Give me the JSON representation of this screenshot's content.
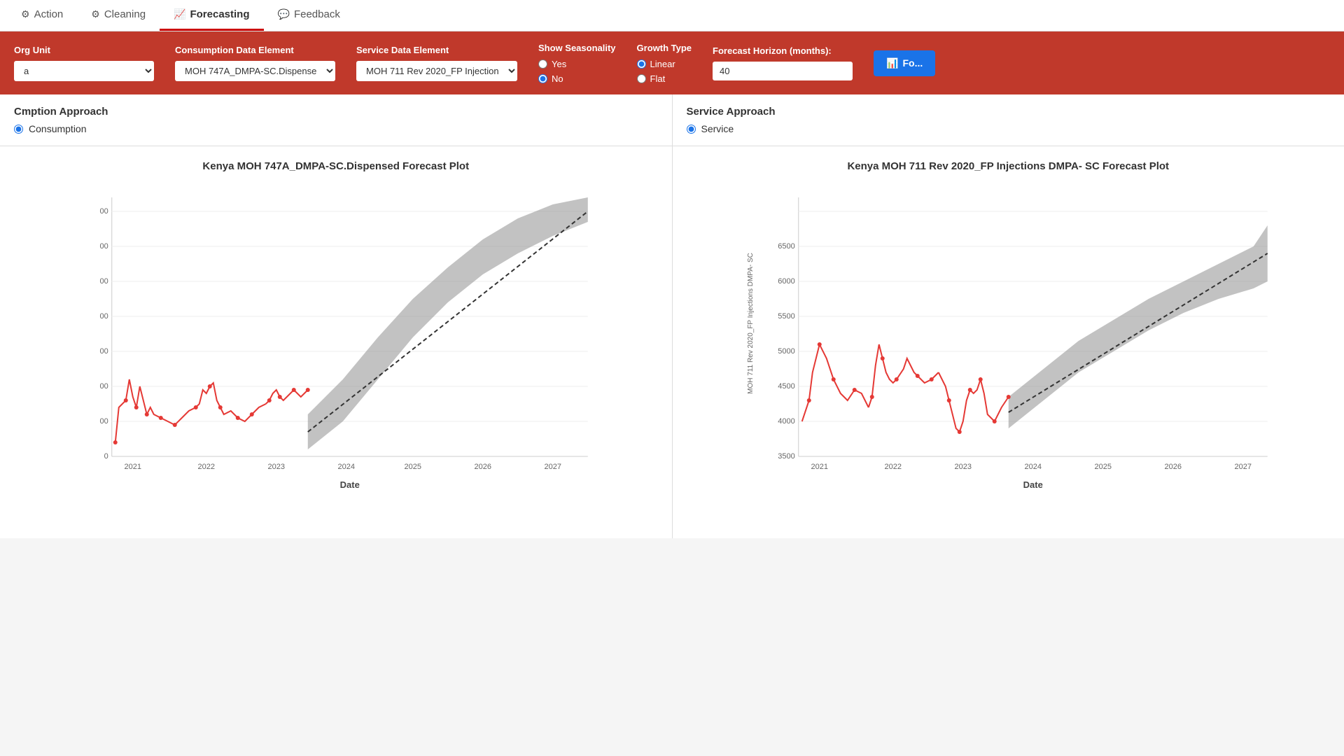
{
  "nav": {
    "tabs": [
      {
        "id": "action",
        "label": "Action",
        "icon": "⚙",
        "active": false
      },
      {
        "id": "cleaning",
        "label": "Cleaning",
        "icon": "⚙",
        "active": false
      },
      {
        "id": "forecasting",
        "label": "Forecasting",
        "icon": "📈",
        "active": true
      },
      {
        "id": "feedback",
        "label": "Feedback",
        "icon": "💬",
        "active": false
      }
    ]
  },
  "toolbar": {
    "org_unit_label": "Org Unit",
    "org_unit_value": "a",
    "consumption_label": "Consumption Data Element",
    "consumption_value": "MOH 747A_DMPA-SC.Dispense",
    "service_label": "Service Data Element",
    "service_value": "MOH 711 Rev 2020_FP Injection",
    "seasonality_label": "Show Seasonality",
    "seasonality_yes": "Yes",
    "seasonality_no": "No",
    "seasonality_selected": "no",
    "growth_label": "Growth Type",
    "growth_linear": "Linear",
    "growth_flat": "Flat",
    "growth_selected": "linear",
    "horizon_label": "Forecast Horizon (months):",
    "horizon_value": "40",
    "forecast_btn": "Fo..."
  },
  "consumption": {
    "section_title": "mption Approach",
    "radio_label": "nsumption",
    "radio_selected": true
  },
  "service": {
    "section_title": "Service Approach",
    "radio_label": "Service",
    "radio_selected": true
  },
  "chart1": {
    "title": "Kenya MOH 747A_DMPA-SC.Dispensed Forecast Plot",
    "x_label": "Date",
    "y_label": "",
    "x_ticks": [
      "2021",
      "2022",
      "2023",
      "2024",
      "2025",
      "2026",
      "2027"
    ],
    "y_ticks": [
      "0",
      "",
      "",
      "",
      "",
      "",
      "",
      "",
      ""
    ]
  },
  "chart2": {
    "title": "Kenya MOH 711 Rev 2020_FP Injections DMPA- SC Forecast Plot",
    "x_label": "Date",
    "y_label": "MOH 711 Rev 2020_FP Injections DMPA- SC",
    "x_ticks": [
      "2021",
      "2022",
      "2023",
      "2024",
      "2025",
      "2026",
      "2027"
    ],
    "y_ticks": [
      "3500",
      "4000",
      "4500",
      "5000",
      "5500",
      "6000",
      "6500"
    ]
  }
}
